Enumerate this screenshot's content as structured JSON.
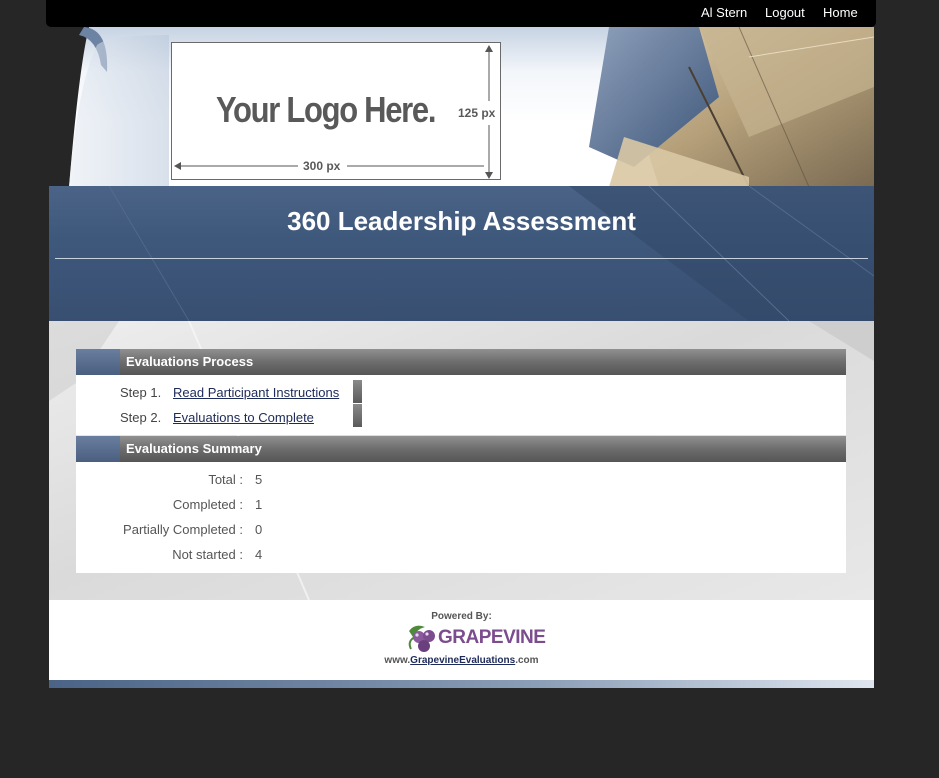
{
  "topnav": {
    "user": "Al Stern",
    "logout": "Logout",
    "home": "Home"
  },
  "header": {
    "logo_placeholder": "Your Logo Here.",
    "logo_height_label": "125 px",
    "logo_width_label": "300 px",
    "title": "360 Leadership Assessment"
  },
  "process": {
    "heading": "Evaluations Process",
    "steps": [
      {
        "number": "Step 1.",
        "label": "Read Participant Instructions"
      },
      {
        "number": "Step 2.",
        "label": "Evaluations to Complete"
      }
    ]
  },
  "summary": {
    "heading": "Evaluations Summary",
    "rows": [
      {
        "label": "Total :",
        "value": "5"
      },
      {
        "label": "Completed :",
        "value": "1"
      },
      {
        "label": "Partially Completed :",
        "value": "0"
      },
      {
        "label": "Not started :",
        "value": "4"
      }
    ]
  },
  "footer": {
    "powered_by": "Powered By:",
    "brand": "GRAPEVINE",
    "url_prefix": "www.",
    "url_link": "GrapevineEvaluations",
    "url_suffix": ".com"
  },
  "colors": {
    "band": "#3e587c",
    "section_bar": "#6d6d6d",
    "link": "#1d2a5a",
    "brand_purple": "#7b4d8e",
    "brand_green": "#4f8a3a"
  }
}
